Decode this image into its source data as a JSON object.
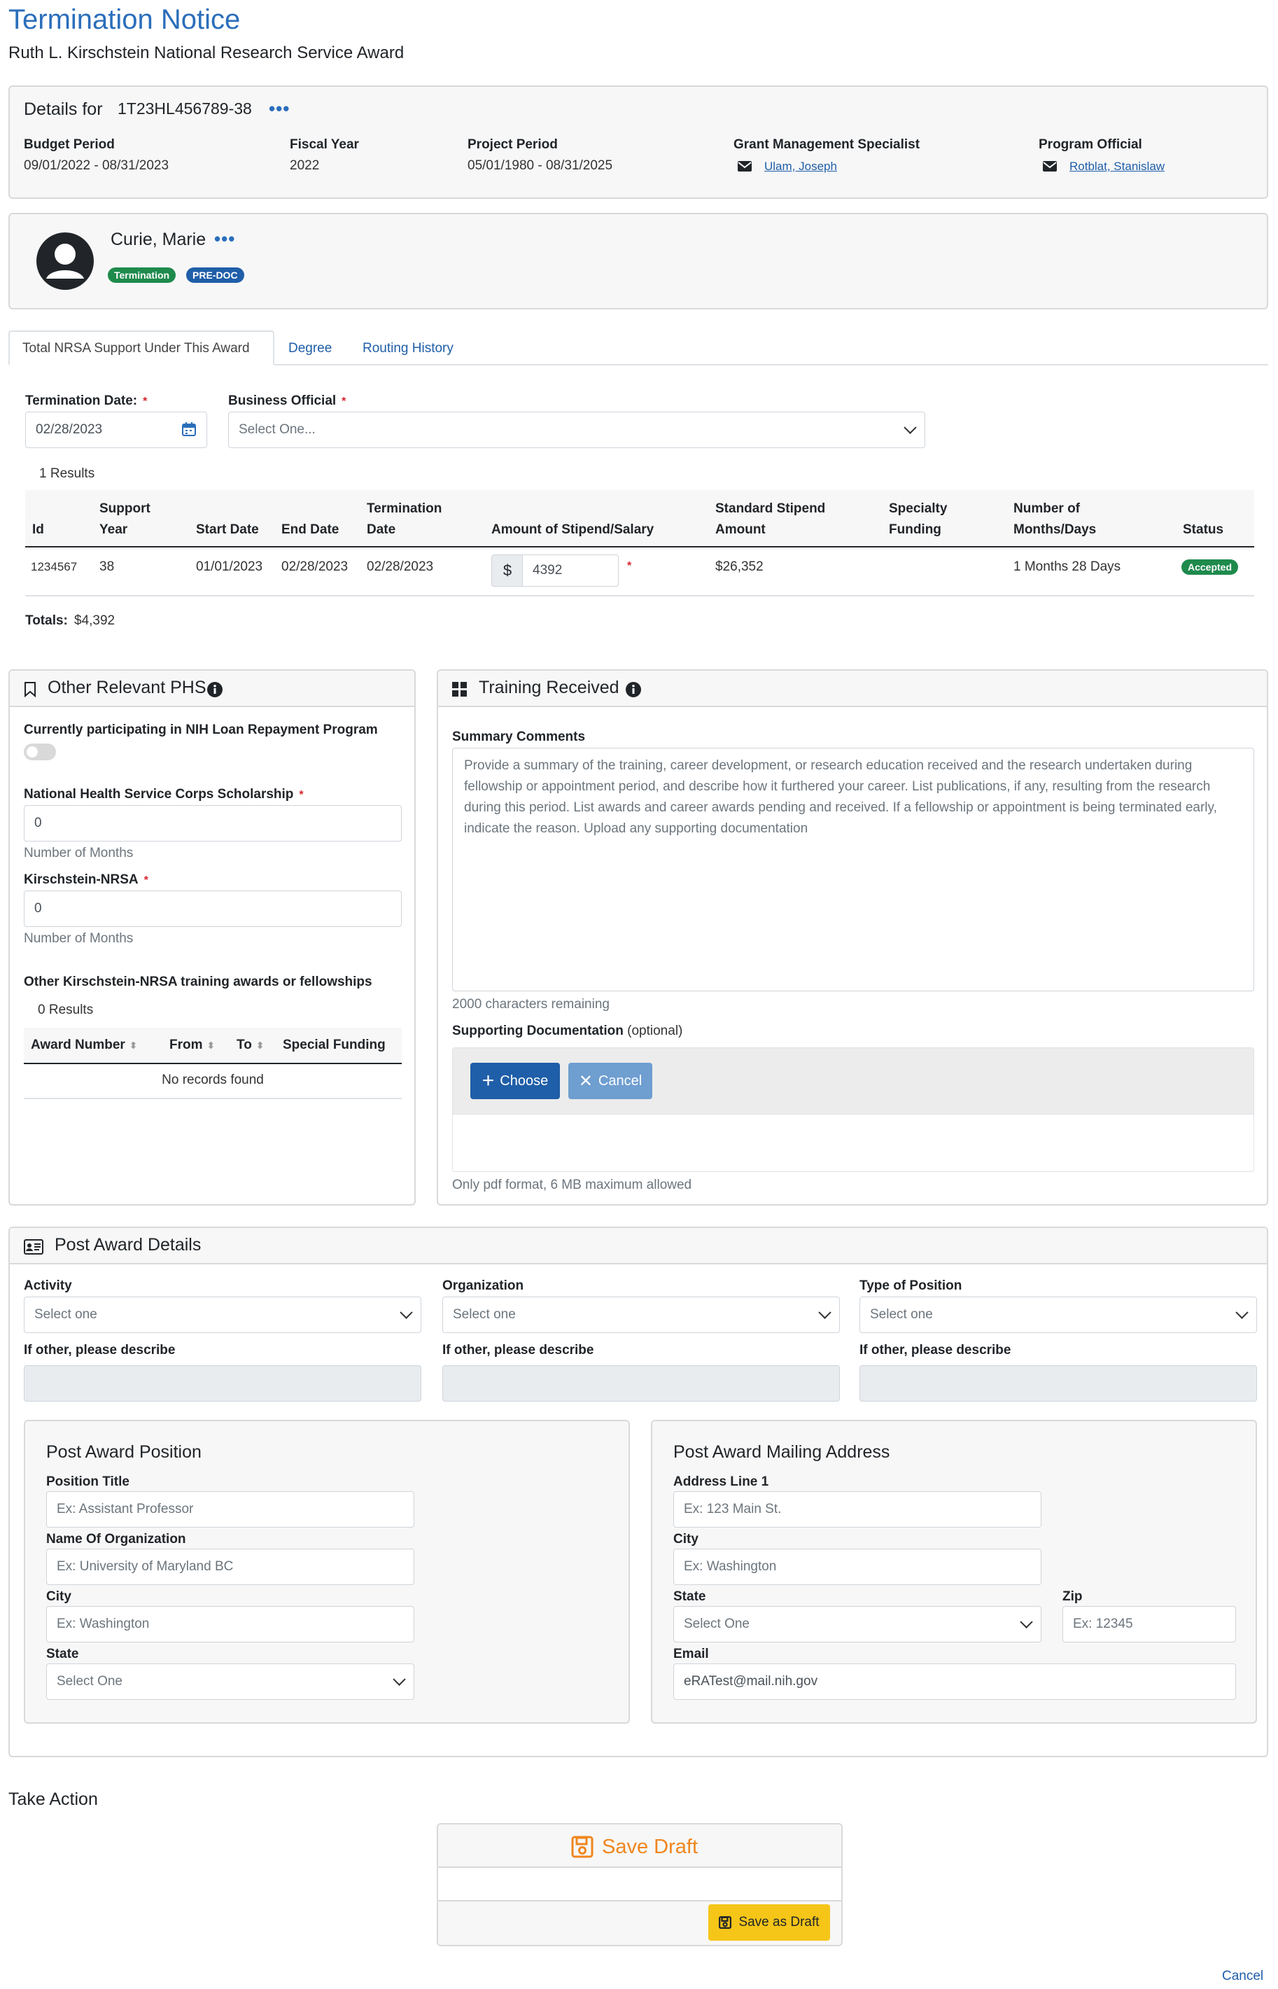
{
  "page": {
    "title": "Termination Notice",
    "subtitle": "Ruth L. Kirschstein National Research Service Award"
  },
  "details": {
    "prefix": "Details for",
    "grant_number": "1T23HL456789-38",
    "budget_period_label": "Budget Period",
    "budget_period": "09/01/2022 - 08/31/2023",
    "fiscal_year_label": "Fiscal Year",
    "fiscal_year": "2022",
    "project_period_label": "Project Period",
    "project_period": "05/01/1980 - 08/31/2025",
    "gms_label": "Grant Management Specialist",
    "gms_name": "Ulam, Joseph",
    "po_label": "Program Official",
    "po_name": "Rotblat, Stanislaw"
  },
  "trainee": {
    "name": "Curie, Marie",
    "badge_termination": "Termination",
    "badge_predoc": "PRE-DOC"
  },
  "tabs": [
    "Total NRSA Support Under This Award",
    "Degree",
    "Routing History"
  ],
  "form": {
    "termination_date_label": "Termination Date:",
    "termination_date": "02/28/2023",
    "business_official_label": "Business Official",
    "business_official_placeholder": "Select One..."
  },
  "support_table": {
    "results": "1 Results",
    "headers": {
      "id": "Id",
      "support_year": [
        "Support",
        "Year"
      ],
      "start_date": "Start Date",
      "end_date": "End Date",
      "termination_date": [
        "Termination",
        "Date"
      ],
      "amount": "Amount of Stipend/Salary",
      "standard": [
        "Standard Stipend",
        "Amount"
      ],
      "specialty": [
        "Specialty",
        "Funding"
      ],
      "months": [
        "Number of",
        "Months/Days"
      ],
      "status": "Status"
    },
    "row": {
      "id": "1234567",
      "support_year": "38",
      "start_date": "01/01/2023",
      "end_date": "02/28/2023",
      "termination_date": "02/28/2023",
      "currency": "$",
      "amount": "4392",
      "standard": "$26,352",
      "months": "1 Months 28 Days",
      "status": "Accepted"
    },
    "totals_label": "Totals:",
    "totals_value": "$4,392"
  },
  "phs": {
    "title": "Other Relevant PHS",
    "loan_label": "Currently participating in NIH Loan Repayment Program",
    "nhsc_label": "National Health Service Corps Scholarship",
    "nhsc_value": "0",
    "nhsc_help": "Number of Months",
    "nrsa_label": "Kirschstein-NRSA",
    "nrsa_value": "0",
    "nrsa_help": "Number of Months",
    "other_label": "Other Kirschstein-NRSA training awards or fellowships",
    "results": "0 Results",
    "col_award": "Award Number",
    "col_from": "From",
    "col_to": "To",
    "col_special": "Special Funding",
    "empty": "No records found"
  },
  "training": {
    "title": "Training Received",
    "summary_label": "Summary Comments",
    "summary_placeholder": "Provide a summary of the training, career development, or research education received and the research undertaken during fellowship or appointment period, and describe how it furthered your career. List publications, if any, resulting from the research during this period. List awards and career awards pending and received. If a fellowship or appointment is being terminated early, indicate the reason. Upload any supporting documentation",
    "chars_remaining": "2000 characters remaining",
    "docs_label": "Supporting Documentation",
    "docs_optional": "(optional)",
    "choose": "Choose",
    "cancel": "Cancel",
    "docs_help": "Only pdf format, 6 MB maximum allowed"
  },
  "post_award": {
    "title": "Post Award Details",
    "activity_label": "Activity",
    "activity_value": "Select one",
    "org_label": "Organization",
    "org_value": "Select one",
    "type_label": "Type of Position",
    "type_value": "Select one",
    "other_label": "If other, please describe",
    "position": {
      "title": "Post Award Position",
      "position_title_label": "Position Title",
      "position_title_ph": "Ex: Assistant Professor",
      "org_name_label": "Name Of Organization",
      "org_name_ph": "Ex: University of Maryland BC",
      "city_label": "City",
      "city_ph": "Ex: Washington",
      "state_label": "State",
      "state_value": "Select One"
    },
    "mailing": {
      "title": "Post Award Mailing Address",
      "address_label": "Address Line 1",
      "address_ph": "Ex: 123 Main St.",
      "city_label": "City",
      "city_ph": "Ex: Washington",
      "state_label": "State",
      "state_value": "Select One",
      "zip_label": "Zip",
      "zip_ph": "Ex: 12345",
      "email_label": "Email",
      "email_value": "eRATest@mail.nih.gov"
    }
  },
  "action": {
    "title": "Take Action",
    "save_draft_title": "Save Draft",
    "save_as_draft": "Save as Draft",
    "cancel": "Cancel"
  },
  "colors": {
    "accent": "#2a6ebb",
    "termination_badge": "#1e8a4c",
    "predoc_badge": "#1f5ea8",
    "accepted_badge": "#1e8a4c",
    "save_orange": "#f0861e",
    "save_button": "#f5c518",
    "choose_button": "#1f5ea8",
    "cancel_button": "#6f9ed0",
    "required": "#d9232d"
  }
}
